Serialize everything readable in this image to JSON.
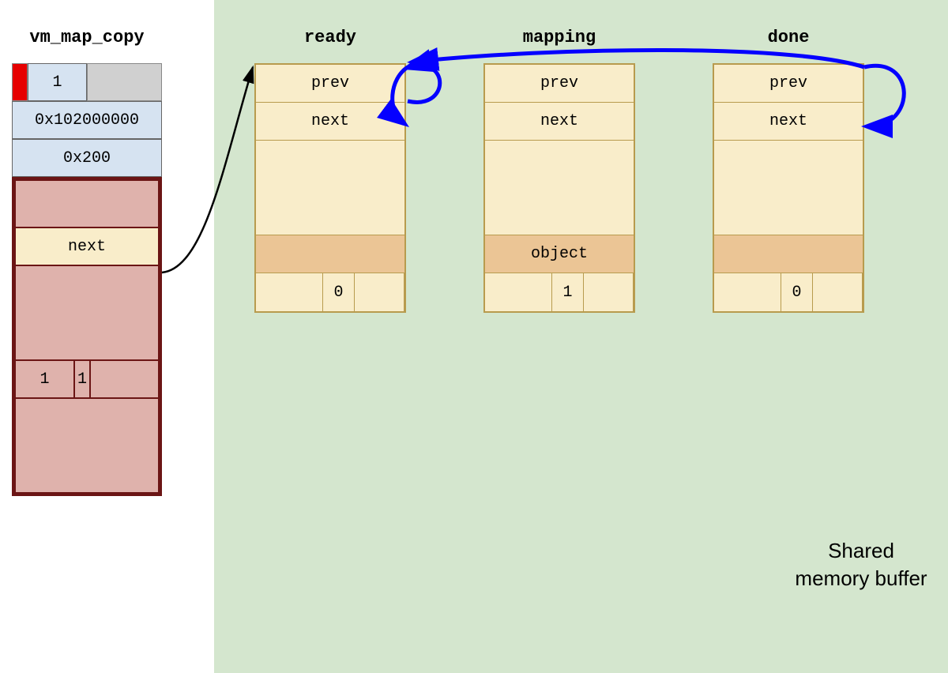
{
  "vm_map_copy": {
    "title": "vm_map_copy",
    "type_value": "1",
    "offset": "0x102000000",
    "size": "0x200",
    "embedded": {
      "next_label": "next",
      "flag_a": "1",
      "flag_b": "1"
    }
  },
  "entries": {
    "ready": {
      "title": "ready",
      "prev": "prev",
      "next": "next",
      "object": "",
      "flag": "0"
    },
    "mapping": {
      "title": "mapping",
      "prev": "prev",
      "next": "next",
      "object": "object",
      "flag": "1"
    },
    "done": {
      "title": "done",
      "prev": "prev",
      "next": "next",
      "object": "",
      "flag": "0"
    }
  },
  "shared_caption": "Shared memory buffer"
}
